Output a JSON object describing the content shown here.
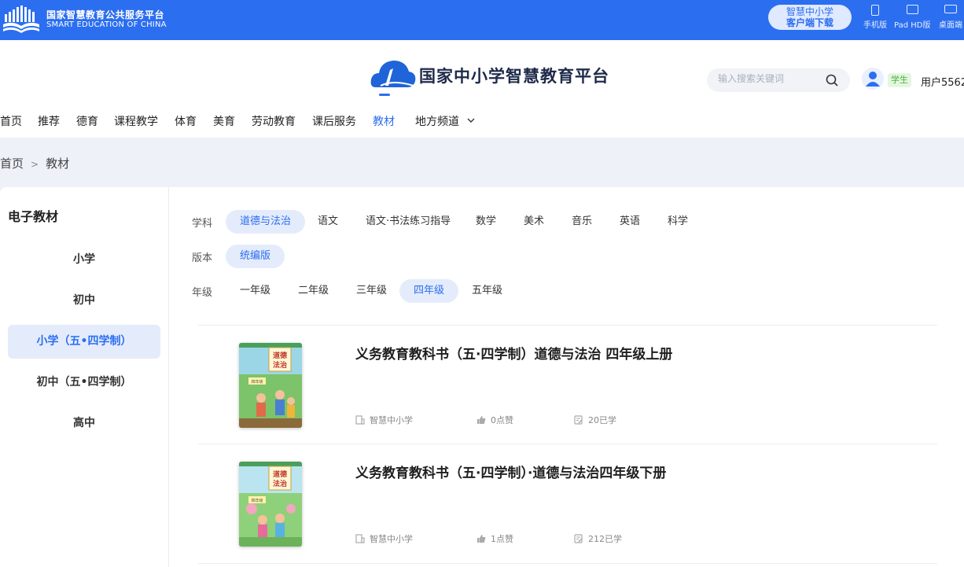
{
  "topbar": {
    "org_cn": "国家智慧教育公共服务平台",
    "org_en": "SMART EDUCATION OF CHINA",
    "download_line1": "智慧中小学",
    "download_line2": "客户端下载",
    "devices": [
      {
        "label": "手机版",
        "icon": "phone-icon"
      },
      {
        "label": "Pad HD版",
        "icon": "tablet-icon"
      },
      {
        "label": "桌面端",
        "icon": "desktop-icon"
      }
    ],
    "color": "#2b6ef0"
  },
  "header": {
    "brand_title": "国家中小学智慧教育平台",
    "nav": [
      {
        "label": "首页"
      },
      {
        "label": "推荐"
      },
      {
        "label": "德育"
      },
      {
        "label": "课程教学"
      },
      {
        "label": "体育"
      },
      {
        "label": "美育"
      },
      {
        "label": "劳动教育"
      },
      {
        "label": "课后服务"
      },
      {
        "label": "教材",
        "active": true
      },
      {
        "label": "地方频道"
      }
    ],
    "search_placeholder": "输入搜索关键词",
    "role_badge": "学生",
    "username": "用户5562"
  },
  "breadcrumb": {
    "home": "首页",
    "separator": ">",
    "current": "教材"
  },
  "sidebar": {
    "title": "电子教材",
    "items": [
      {
        "label": "小学"
      },
      {
        "label": "初中"
      },
      {
        "label": "小学（五•四学制）",
        "active": true
      },
      {
        "label": "初中（五•四学制）"
      },
      {
        "label": "高中"
      }
    ]
  },
  "filters": {
    "subject_label": "学科",
    "subjects": [
      "道德与法治",
      "语文",
      "语文·书法练习指导",
      "数学",
      "美术",
      "音乐",
      "英语",
      "科学"
    ],
    "subject_selected": "道德与法治",
    "edition_label": "版本",
    "editions": [
      "统编版"
    ],
    "edition_selected": "统编版",
    "grade_label": "年级",
    "grades": [
      "一年级",
      "二年级",
      "三年级",
      "四年级",
      "五年级"
    ],
    "grade_selected": "四年级"
  },
  "books": [
    {
      "title": "义务教育教科书（五·四学制）道德与法治 四年级上册",
      "publisher": "智慧中小学",
      "likes": "0点赞",
      "learners": "20已学",
      "cover_title": "道德与法治",
      "cover_grade": "四年级"
    },
    {
      "title": "义务教育教科书（五·四学制）·道德与法治四年级下册",
      "publisher": "智慧中小学",
      "likes": "1点赞",
      "learners": "212已学",
      "cover_title": "道德与法治",
      "cover_grade": "四年级"
    }
  ]
}
